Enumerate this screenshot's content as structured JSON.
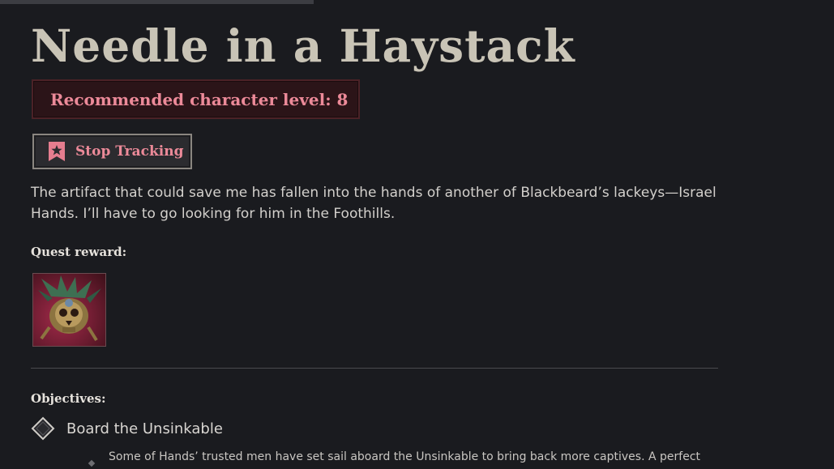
{
  "quest": {
    "title": "Needle in a Haystack",
    "recommended_level": "Recommended character level: 8",
    "track_button_label": "Stop Tracking",
    "description": "The artifact that could save me has fallen into the hands of another of Blackbeard’s lackeys—Israel Hands. I’ll have to go looking for him in the Foothills.",
    "reward_heading": "Quest reward:",
    "reward_item_icon": "ornate-skull-relic-icon",
    "objectives_heading": "Objectives:",
    "objectives": [
      {
        "label": "Board the Unsinkable",
        "details": "Some of Hands’ trusted men have set sail aboard the Unsinkable to bring back more captives. A perfect"
      }
    ]
  },
  "colors": {
    "background": "#1a1b1f",
    "title": "#c9c4b6",
    "accent_pink": "#ec8a99",
    "level_box_bg": "#2b1418",
    "reward_bg": "#8a2340"
  }
}
